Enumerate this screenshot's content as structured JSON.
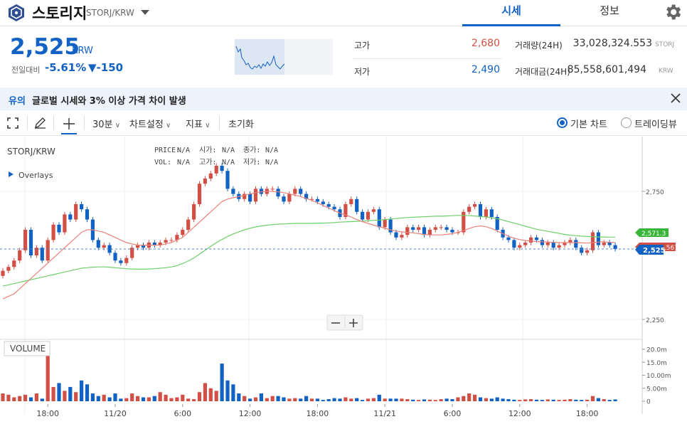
{
  "header": {
    "coin_name": "스토리지",
    "pair": "STORJ/KRW",
    "tabs": [
      "시세",
      "정보"
    ]
  },
  "summary": {
    "price": "2,525",
    "price_unit": "KRW",
    "change_label": "전일대비",
    "change_rate": "-5.61%",
    "change_price": "▼-150",
    "high_label": "고가",
    "high_value": "2,680",
    "low_label": "저가",
    "low_value": "2,490",
    "volume_label": "거래량(24H)",
    "volume_value": "33,028,324.553",
    "volume_unit": "STORJ",
    "amount_label": "거래대금(24H)",
    "amount_value": "85,558,601,494",
    "amount_unit": "KRW"
  },
  "notice": {
    "tag": "유의",
    "text": "글로벌 시세와 3% 이상 가격 차이 발생"
  },
  "toolbar": {
    "interval": "30분",
    "settings": "차트설정",
    "indicator": "지표",
    "reset": "초기화",
    "basic_chart": "기본 차트",
    "tradingview": "트레이딩뷰"
  },
  "colors": {
    "up": "#d24f45",
    "down": "#1261c4",
    "accent": "#1261c4",
    "ma_short": "#e8837a",
    "ma_long": "#6fcf6b"
  },
  "chart_data": {
    "type": "candlestick",
    "symbol": "STORJ/KRW",
    "overlays_label": "Overlays",
    "info_row1": [
      "PRICE:",
      "N/A",
      "시가:",
      "N/A",
      "종가:",
      "N/A"
    ],
    "info_row2": [
      "VOL:",
      "N/A",
      "고가:",
      "N/A",
      "저가:",
      "N/A"
    ],
    "y_ticks": [
      "2,750",
      "2,250"
    ],
    "y_tick_values": [
      2750,
      2250
    ],
    "last_price_label": "2,525",
    "ma_long_label": "2,571.3",
    "ma_short_label": "2,567",
    "volume_label": "VOLUME",
    "volume_ticks": [
      "20.0m",
      "15.0m",
      "10.00m",
      "5.00m",
      "0"
    ],
    "volume_tick_values": [
      20,
      15,
      10,
      5,
      0
    ],
    "x_ticks": [
      "18:00",
      "11/20",
      "6:00",
      "12:00",
      "18:00",
      "11/21",
      "6:00",
      "12:00",
      "18:00"
    ],
    "x_tick_index": [
      8,
      20,
      32,
      44,
      56,
      68,
      80,
      92,
      104
    ],
    "closes": [
      2440,
      2455,
      2480,
      2520,
      2600,
      2500,
      2530,
      2480,
      2560,
      2620,
      2590,
      2660,
      2640,
      2700,
      2680,
      2640,
      2560,
      2530,
      2540,
      2510,
      2480,
      2470,
      2490,
      2530,
      2540,
      2530,
      2550,
      2540,
      2550,
      2560,
      2560,
      2580,
      2600,
      2640,
      2700,
      2780,
      2800,
      2820,
      2850,
      2830,
      2760,
      2740,
      2720,
      2740,
      2710,
      2760,
      2740,
      2760,
      2760,
      2730,
      2710,
      2740,
      2760,
      2740,
      2720,
      2720,
      2710,
      2700,
      2690,
      2680,
      2650,
      2700,
      2720,
      2670,
      2640,
      2670,
      2680,
      2610,
      2640,
      2590,
      2570,
      2580,
      2610,
      2600,
      2610,
      2580,
      2600,
      2610,
      2610,
      2600,
      2590,
      2590,
      2670,
      2690,
      2700,
      2650,
      2680,
      2650,
      2600,
      2570,
      2560,
      2530,
      2540,
      2550,
      2570,
      2560,
      2540,
      2550,
      2530,
      2540,
      2550,
      2560,
      2530,
      2510,
      2520,
      2590,
      2540,
      2550,
      2540,
      2525
    ],
    "ma_short": [
      2330,
      2340,
      2350,
      2370,
      2390,
      2410,
      2430,
      2450,
      2470,
      2490,
      2510,
      2530,
      2550,
      2570,
      2590,
      2600,
      2600,
      2595,
      2590,
      2580,
      2570,
      2560,
      2550,
      2545,
      2540,
      2540,
      2540,
      2540,
      2540,
      2545,
      2550,
      2560,
      2570,
      2590,
      2610,
      2630,
      2650,
      2670,
      2690,
      2710,
      2720,
      2725,
      2730,
      2735,
      2740,
      2745,
      2748,
      2750,
      2750,
      2748,
      2745,
      2740,
      2735,
      2730,
      2722,
      2715,
      2705,
      2695,
      2685,
      2675,
      2665,
      2658,
      2650,
      2640,
      2632,
      2625,
      2618,
      2612,
      2606,
      2600,
      2595,
      2592,
      2590,
      2588,
      2585,
      2582,
      2580,
      2580,
      2580,
      2582,
      2585,
      2590,
      2597,
      2605,
      2612,
      2615,
      2612,
      2605,
      2595,
      2585,
      2575,
      2567,
      2562,
      2558,
      2556,
      2554,
      2553,
      2552,
      2551,
      2550,
      2550,
      2550,
      2550,
      2549,
      2548,
      2550,
      2552,
      2553,
      2551,
      2550
    ],
    "ma_long": [
      2380,
      2385,
      2390,
      2395,
      2400,
      2405,
      2410,
      2415,
      2420,
      2425,
      2430,
      2435,
      2440,
      2445,
      2450,
      2452,
      2454,
      2455,
      2455,
      2454,
      2452,
      2450,
      2448,
      2447,
      2446,
      2446,
      2447,
      2448,
      2450,
      2452,
      2455,
      2460,
      2468,
      2478,
      2490,
      2505,
      2520,
      2535,
      2550,
      2562,
      2574,
      2584,
      2592,
      2600,
      2606,
      2611,
      2615,
      2618,
      2620,
      2622,
      2623,
      2624,
      2625,
      2625,
      2625,
      2625,
      2626,
      2626,
      2627,
      2628,
      2630,
      2631,
      2632,
      2633,
      2634,
      2635,
      2637,
      2638,
      2640,
      2642,
      2644,
      2646,
      2648,
      2649,
      2650,
      2651,
      2652,
      2653,
      2653,
      2654,
      2655,
      2656,
      2656,
      2655,
      2654,
      2652,
      2650,
      2647,
      2643,
      2638,
      2632,
      2626,
      2620,
      2614,
      2608,
      2602,
      2598,
      2594,
      2590,
      2586,
      2582,
      2579,
      2577,
      2575,
      2574,
      2573,
      2572,
      2572,
      2571.5,
      2571.3
    ],
    "volume_m": [
      3,
      2.5,
      1.5,
      2,
      2.5,
      1.5,
      3,
      1,
      20,
      5.5,
      7,
      4,
      5.5,
      3.5,
      8,
      6.5,
      3,
      2,
      2.5,
      1.5,
      3,
      1,
      1.2,
      3,
      2,
      1.5,
      1.5,
      2,
      3.5,
      2.5,
      1.2,
      1.5,
      2.5,
      1,
      0.8,
      3.5,
      7,
      5,
      4,
      14.5,
      8,
      6.5,
      3,
      2,
      1,
      1.5,
      3,
      1.2,
      2,
      2,
      1.5,
      1,
      1.2,
      1,
      2,
      1,
      1,
      0.5,
      0.8,
      1.2,
      1,
      1.5,
      1,
      1.2,
      0.5,
      1,
      1.2,
      2.5,
      1,
      1,
      1,
      1,
      0.8,
      0.6,
      0.5,
      0.7,
      0.6,
      0.5,
      0.8,
      1,
      0.8,
      1.5,
      2,
      3,
      2.5,
      1.5,
      1.2,
      1,
      1.5,
      1,
      0.8,
      0.6,
      0.5,
      0.7,
      0.8,
      0.6,
      0.5,
      0.7,
      0.6,
      0.5,
      0.6,
      0.8,
      0.6,
      0.5,
      0.6,
      2,
      1.2,
      0.8,
      0.5,
      0.7
    ]
  }
}
